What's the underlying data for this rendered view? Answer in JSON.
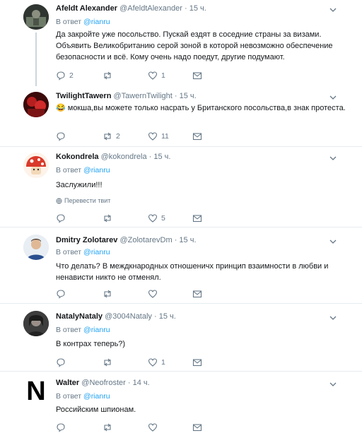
{
  "tweets": [
    {
      "name": "Afeldt Alexander",
      "handle": "@AfeldtAlexander",
      "dot": "·",
      "time": "15 ч.",
      "reply_prefix": "В ответ",
      "reply_to": "@rianru",
      "text": "Да закройте уже посольство. Пускай ездят в соседние страны за визами. Объявить Великобританию серой зоной в которой невозможно обеспечение безопасности и всё. Кому очень надо поедут, другие подумают.",
      "replies": "2",
      "retweets": "",
      "likes": "1",
      "avatar_icon": "avatar-dark-photo"
    },
    {
      "name": "TwilightTawern",
      "handle": "@TawernTwilight",
      "dot": "·",
      "time": "15 ч.",
      "text": "😂 мокша,вы можете только насрать у Британского посольства,в знак протеста.",
      "replies": "",
      "retweets": "2",
      "likes": "11",
      "avatar_icon": "avatar-red-photo"
    },
    {
      "name": "Kokondrela",
      "handle": "@kokondrela",
      "dot": "·",
      "time": "15 ч.",
      "reply_prefix": "В ответ",
      "reply_to": "@rianru",
      "text": "Заслужили!!!",
      "translate": "Перевести твит",
      "replies": "",
      "retweets": "",
      "likes": "5",
      "avatar_icon": "mushroom-avatar"
    },
    {
      "name": "Dmitry Zolotarev",
      "handle": "@ZolotarevDm",
      "dot": "·",
      "time": "15 ч.",
      "reply_prefix": "В ответ",
      "reply_to": "@rianru",
      "text": "Что делать? В междкнародных отношеничх принцип взаимности в любви и ненависти никто не отменял.",
      "replies": "",
      "retweets": "",
      "likes": "",
      "avatar_icon": "avatar-person-blue"
    },
    {
      "name": "NatalyNataly",
      "handle": "@3004Nataly",
      "dot": "·",
      "time": "15 ч.",
      "reply_prefix": "В ответ",
      "reply_to": "@rianru",
      "text": "В контрах теперь?)",
      "replies": "",
      "retweets": "",
      "likes": "1",
      "avatar_icon": "avatar-dark-portrait"
    },
    {
      "name": "Walter",
      "handle": "@Neofroster",
      "dot": "·",
      "time": "14 ч.",
      "reply_prefix": "В ответ",
      "reply_to": "@rianru",
      "text": "Российским шпионам.",
      "avatar_letter": "N",
      "replies": "",
      "retweets": "",
      "likes": "",
      "avatar_icon": "avatar-letter-n"
    }
  ],
  "colors": {
    "link": "#1da1f2",
    "muted": "#657786",
    "divider": "#e6ecf0",
    "thread": "#ccd6dd"
  }
}
